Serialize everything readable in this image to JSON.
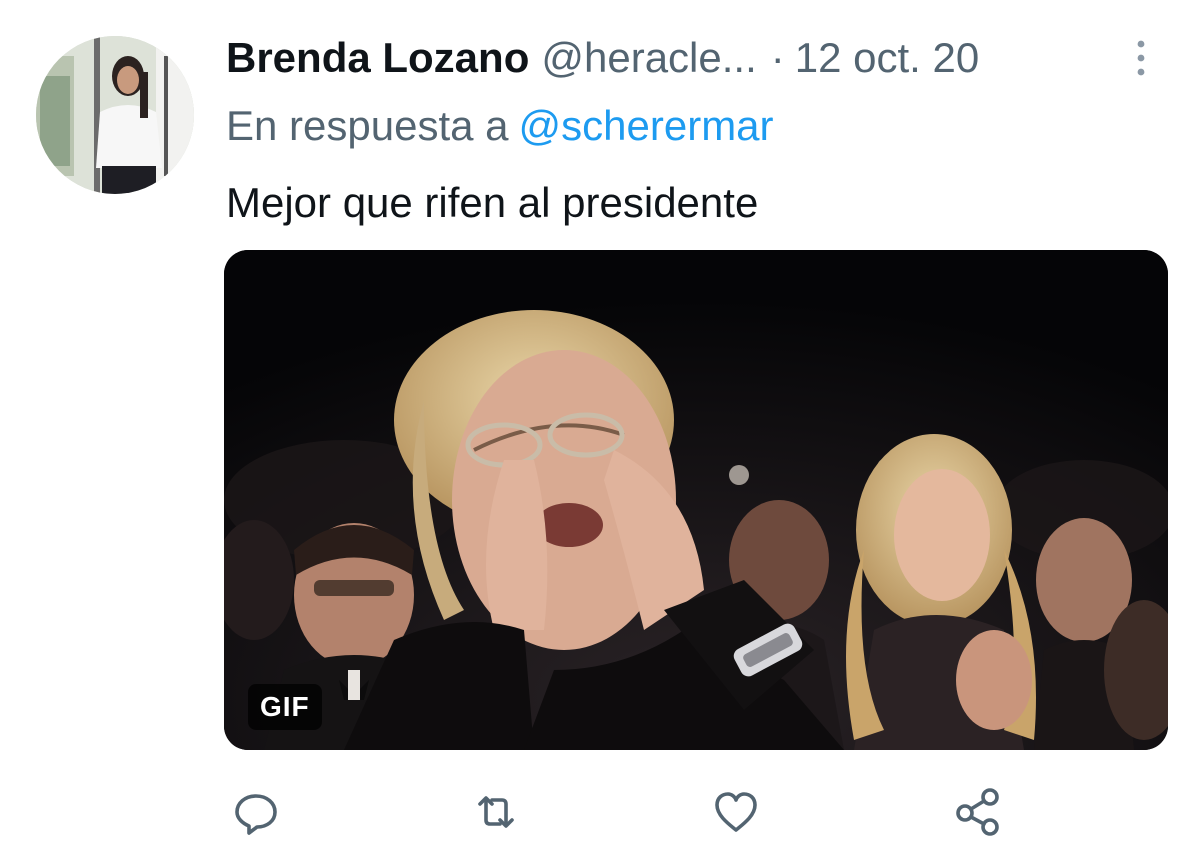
{
  "tweet": {
    "display_name": "Brenda Lozano",
    "handle": "@heracle...",
    "separator": "·",
    "date": "12 oct. 20",
    "reply_prefix": "En respuesta a",
    "reply_mention": "@scherermar",
    "text": "Mejor que rifen al presidente"
  },
  "media": {
    "badge": "GIF"
  },
  "icons": {
    "more": "more-vertical-icon",
    "reply": "reply-icon",
    "retweet": "retweet-icon",
    "like": "like-icon",
    "share": "share-icon"
  },
  "colors": {
    "text_primary": "#0f1419",
    "text_secondary": "#536471",
    "link": "#1d9bf0"
  }
}
